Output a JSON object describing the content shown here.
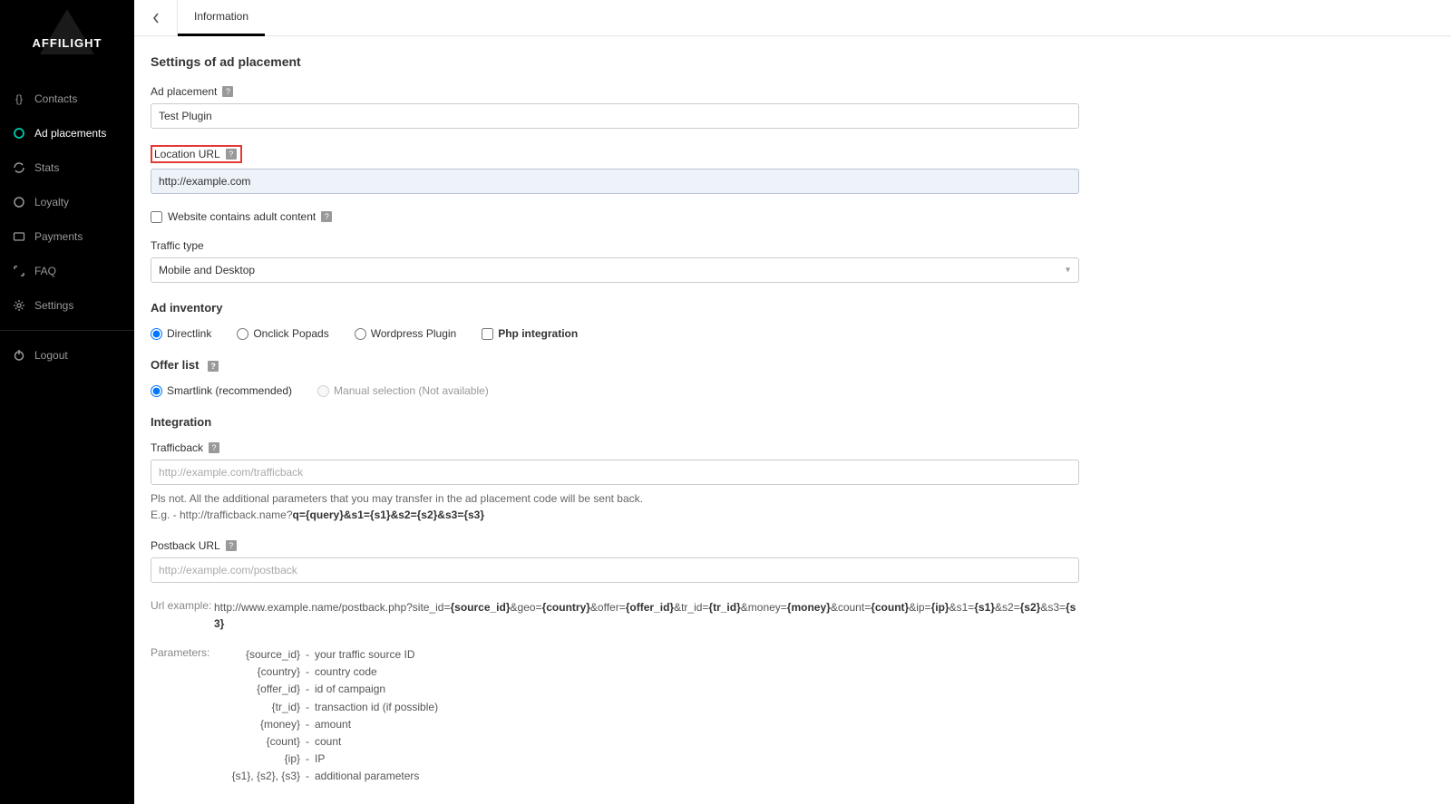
{
  "logo": "AFFILIGHT",
  "nav": {
    "contacts": "Contacts",
    "adplacements": "Ad placements",
    "stats": "Stats",
    "loyalty": "Loyalty",
    "payments": "Payments",
    "faq": "FAQ",
    "settings": "Settings",
    "logout": "Logout"
  },
  "tab": {
    "information": "Information"
  },
  "settings_title": "Settings of ad placement",
  "form": {
    "ad_placement_label": "Ad placement",
    "ad_placement_value": "Test Plugin",
    "location_url_label": "Location URL",
    "location_url_value": "http://example.com",
    "adult_label": "Website contains adult content",
    "traffic_type_label": "Traffic type",
    "traffic_type_value": "Mobile and Desktop"
  },
  "ad_inventory": {
    "title": "Ad inventory",
    "options": {
      "directlink": "Directlink",
      "onclick": "Onclick Popads",
      "wordpress": "Wordpress Plugin",
      "php": "Php integration"
    }
  },
  "offer_list": {
    "title": "Offer list",
    "smartlink": "Smartlink (recommended)",
    "manual": "Manual selection (Not available)"
  },
  "integration": {
    "title": "Integration",
    "trafficback_label": "Trafficback",
    "trafficback_placeholder": "http://example.com/trafficback",
    "trafficback_note1": "Pls not. All the additional parameters that you may transfer in the ad placement code will be sent back.",
    "trafficback_note2_prefix": "E.g. - http://trafficback.name?",
    "trafficback_note2_bold": "q={query}&s1={s1}&s2={s2}&s3={s3}",
    "postback_label": "Postback URL",
    "postback_placeholder": "http://example.com/postback",
    "url_example_label": "Url example:",
    "url_example_prefix": "http://www.example.name/postback.php?site_id=",
    "url_example_parts": {
      "p1": "{source_id}",
      "t1": "&geo=",
      "p2": "{country}",
      "t2": "&offer=",
      "p3": "{offer_id}",
      "t3": "&tr_id=",
      "p4": "{tr_id}",
      "t4": "&money=",
      "p5": "{money}",
      "t5": "&count=",
      "p6": "{count}",
      "t6": "&ip=",
      "p7": "{ip}",
      "t7": "&s1=",
      "p8": "{s1}",
      "t8": "&s2=",
      "p9": "{s2}",
      "t9": "&s3=",
      "p10": "{s3}"
    },
    "parameters_label": "Parameters:",
    "parameters": [
      {
        "key": "{source_id}",
        "desc": "your traffic source ID"
      },
      {
        "key": "{country}",
        "desc": "country code"
      },
      {
        "key": "{offer_id}",
        "desc": "id of campaign"
      },
      {
        "key": "{tr_id}",
        "desc": "transaction id (if possible)"
      },
      {
        "key": "{money}",
        "desc": "amount"
      },
      {
        "key": "{count}",
        "desc": "count"
      },
      {
        "key": "{ip}",
        "desc": "IP"
      },
      {
        "key": "{s1}, {s2}, {s3}",
        "desc": "additional parameters"
      }
    ]
  }
}
